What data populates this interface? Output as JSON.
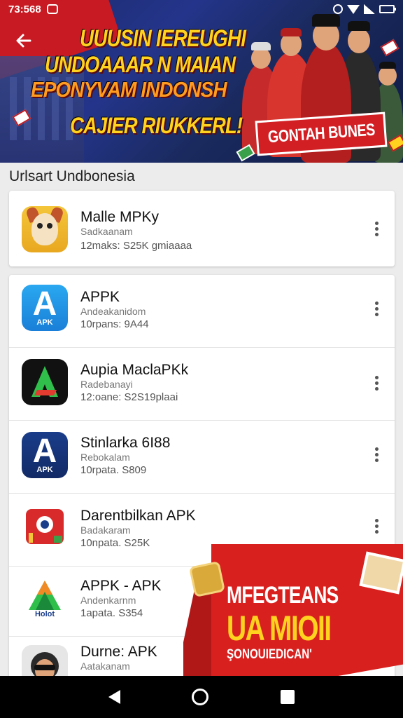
{
  "status_bar": {
    "time": "73:568"
  },
  "hero": {
    "lines": [
      "UUUSIN IEREUGHI",
      "UNDOAAAR N MAIAN",
      "EPONYVAM INDONSH",
      "CAJIER RIUKKERL!"
    ],
    "badge": "GONTAH BUNES"
  },
  "section_title": "Urlsart Undbonesia",
  "apps": [
    {
      "name": "Malle MPKy",
      "developer": "Sadkaanam",
      "meta": "12maks: S25K gmiaaaa",
      "icon": "fox-mascot-icon"
    },
    {
      "name": "APPK",
      "developer": "Andeakanidom",
      "meta": "10rpans: 9A44",
      "icon": "apk-a-blue-icon",
      "icon_label": "APK"
    },
    {
      "name": "Aupia MaclaPKk",
      "developer": "Radebanayi",
      "meta": "12:oane: S2S19plaai",
      "icon": "apk-a-dark-icon"
    },
    {
      "name": "Stinlarka 6I88",
      "developer": "Rebokalam",
      "meta": "10rpata. S809",
      "icon": "apk-a-navy-icon",
      "icon_label": "APK"
    },
    {
      "name": "Darentbilkan APK",
      "developer": "Badakaram",
      "meta": "10npata. S25K",
      "icon": "red-camera-icon"
    },
    {
      "name": "APPK - APK",
      "developer": "Andenkarnm",
      "meta": "1apata. S354",
      "icon": "green-triangle-icon",
      "icon_label": "Holot"
    },
    {
      "name": "Durne: APK",
      "developer": "Aatakanam",
      "meta": "",
      "icon": "person-avatar-icon"
    }
  ],
  "promo": {
    "line1": "MFEGTEANS",
    "line2": "UA MIOII",
    "line3": "ŞONOUIEDICAN'"
  },
  "colors": {
    "hero_bg": "#1b2a6b",
    "accent_red": "#d21f24",
    "accent_yellow": "#ffd21f"
  }
}
